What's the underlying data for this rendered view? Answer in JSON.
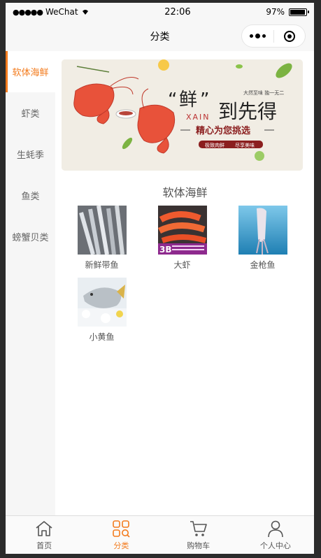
{
  "status": {
    "carrier": "WeChat",
    "time": "22:06",
    "battery": "97%",
    "battery_level": 0.97
  },
  "navbar": {
    "title": "分类"
  },
  "sidebar": {
    "items": [
      {
        "label": "软体海鲜",
        "active": true
      },
      {
        "label": "虾类",
        "active": false
      },
      {
        "label": "生蚝季",
        "active": false
      },
      {
        "label": "鱼类",
        "active": false
      },
      {
        "label": "螃蟹贝类",
        "active": false
      }
    ]
  },
  "banner": {
    "quote_big": "鲜",
    "pinyin": "XAIN",
    "headline": "到先得",
    "tagline_small": "大然至味  独一无二",
    "subtitle": "精心为您挑选",
    "pill_left": "极致肉鲜",
    "pill_right": "尽享美味"
  },
  "category": {
    "title": "软体海鲜"
  },
  "products": [
    {
      "name": "新鲜带鱼"
    },
    {
      "name": "大虾",
      "badge": "3B"
    },
    {
      "name": "金枪鱼"
    },
    {
      "name": "小黄鱼"
    }
  ],
  "tabbar": {
    "items": [
      {
        "label": "首页",
        "icon": "home-icon",
        "active": false
      },
      {
        "label": "分类",
        "icon": "category-icon",
        "active": true
      },
      {
        "label": "购物车",
        "icon": "cart-icon",
        "active": false
      },
      {
        "label": "个人中心",
        "icon": "user-icon",
        "active": false
      }
    ]
  },
  "colors": {
    "accent": "#f37b1d",
    "sidebar_bg": "#f6f6f6"
  }
}
